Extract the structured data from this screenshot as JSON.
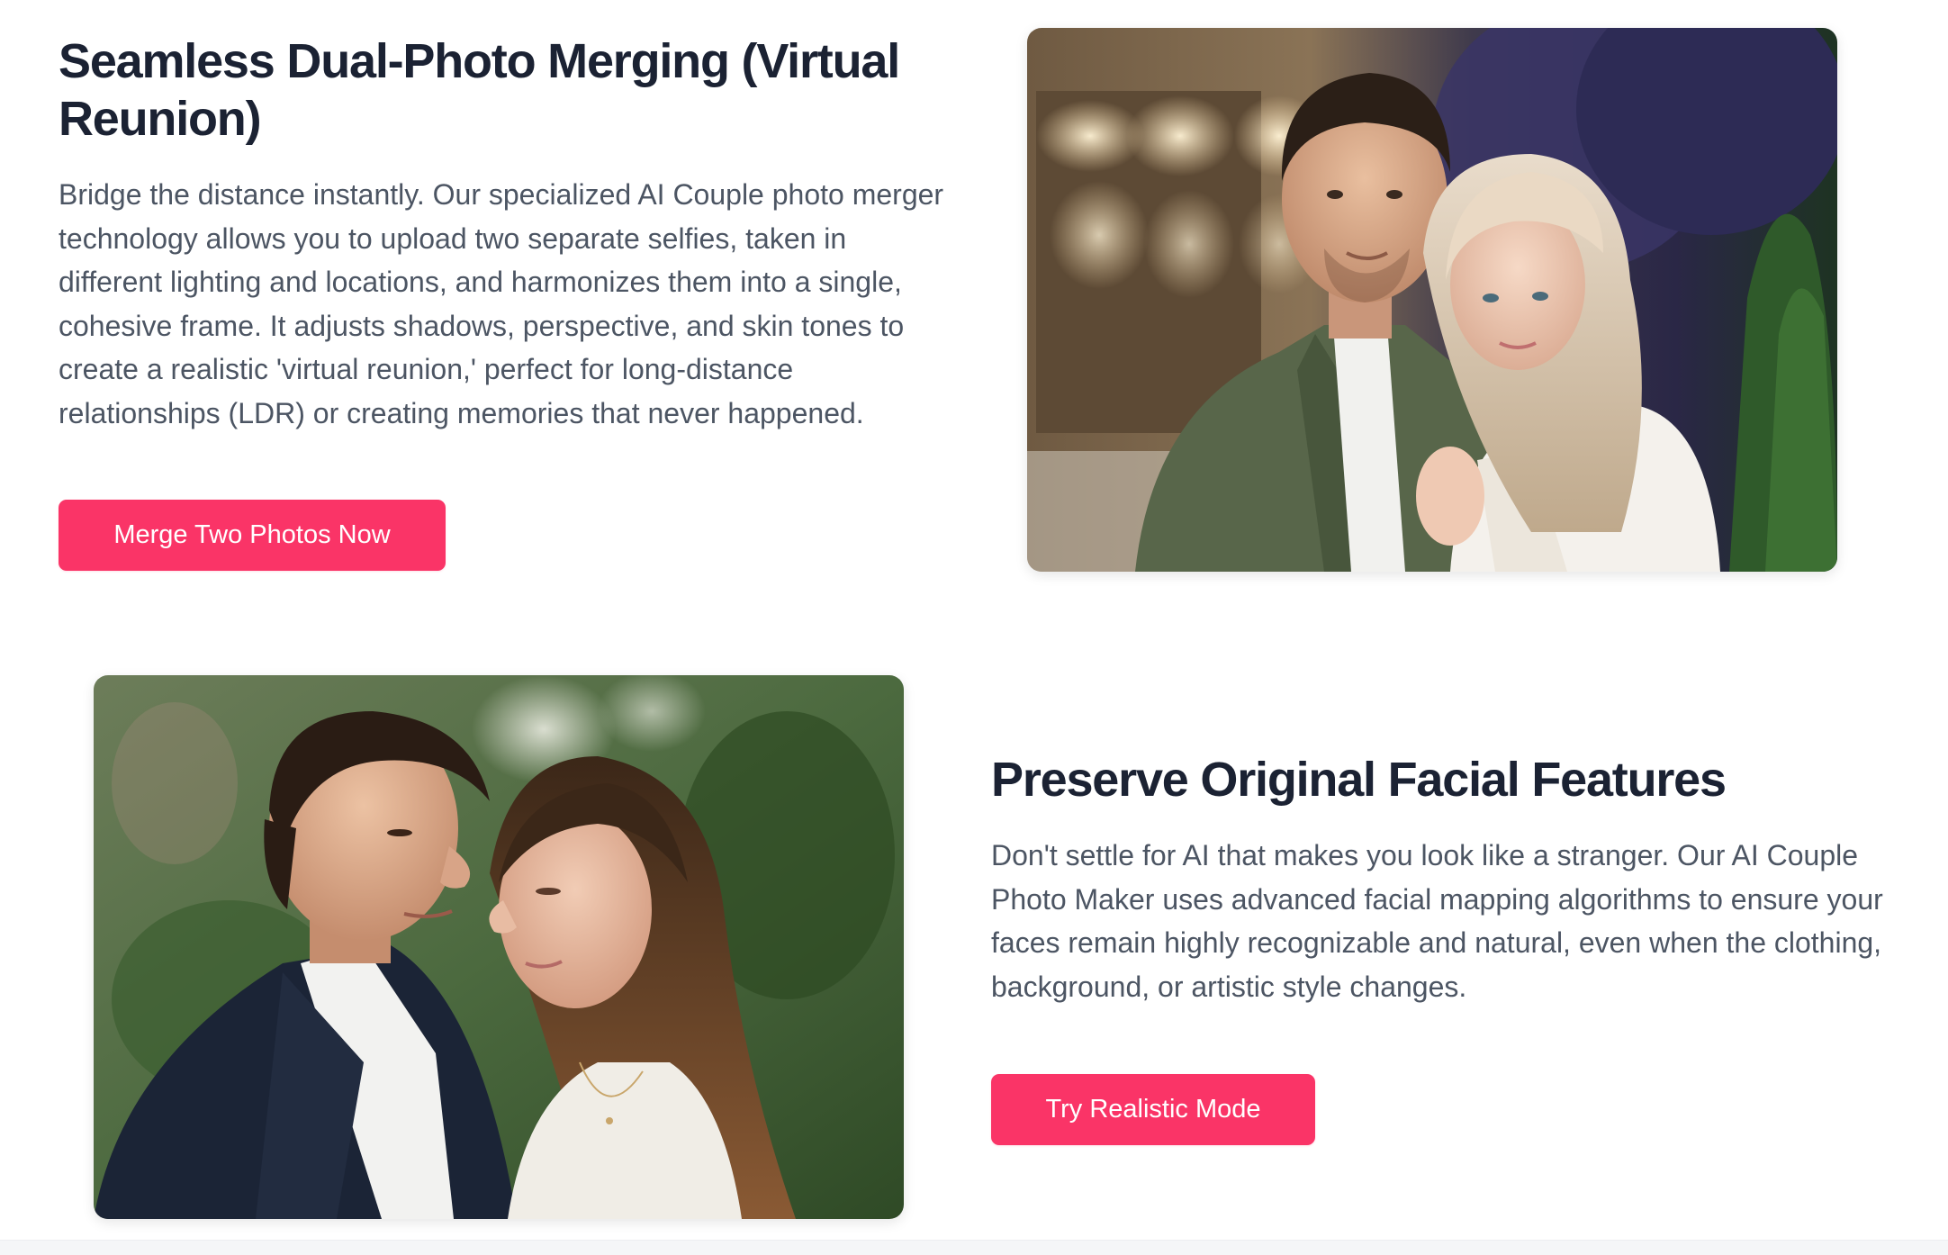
{
  "features": [
    {
      "title": "Seamless Dual-Photo Merging (Virtual Reunion)",
      "description": "Bridge the distance instantly. Our specialized AI Couple photo merger technology allows you to upload two separate selfies, taken in different lighting and locations, and harmonizes them into a single, cohesive frame. It adjusts shadows, perspective, and skin tones to create a realistic 'virtual reunion,' perfect for long-distance relationships (LDR) or creating memories that never happened.",
      "button_label": "Merge Two Photos Now",
      "image_subject": "couple-portrait-embrace"
    },
    {
      "title": "Preserve Original Facial Features",
      "description": "Don't settle for AI that makes you look like a stranger. Our AI Couple Photo Maker uses advanced facial mapping algorithms to ensure your faces remain highly recognizable and natural, even when the clothing, background, or artistic style changes.",
      "button_label": "Try Realistic Mode",
      "image_subject": "couple-portrait-nose-touch"
    }
  ],
  "colors": {
    "accent": "#fa3467",
    "heading": "#1b2233",
    "body_text": "#4c5563",
    "background": "#ffffff"
  }
}
